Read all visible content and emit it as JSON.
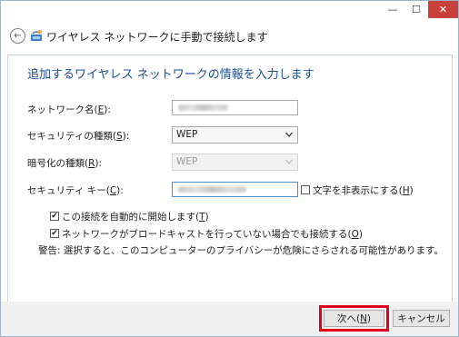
{
  "window": {
    "title": "ワイヤレス ネットワークに手動で接続します",
    "minimize_glyph": "—",
    "maximize_glyph": "☐",
    "close_glyph": "✕",
    "back_glyph": "←"
  },
  "form": {
    "heading": "追加するワイヤレス ネットワークの情報を入力します",
    "network_name": {
      "label": "ネットワーク名(",
      "key": "E",
      "suffix": "):"
    },
    "security_type": {
      "label": "セキュリティの種類(",
      "key": "S",
      "suffix": "):",
      "value": "WEP"
    },
    "encryption_type": {
      "label": "暗号化の種類(",
      "key": "R",
      "suffix": "):",
      "value": "WEP"
    },
    "security_key": {
      "label": "セキュリティ キー(",
      "key": "C",
      "suffix": "):"
    },
    "hide_chars": {
      "label": "文字を非表示にする(",
      "key": "H",
      "suffix": ")",
      "checked": false
    },
    "auto_start": {
      "label": "この接続を自動的に開始します(",
      "key": "T",
      "suffix": ")",
      "checked": true
    },
    "connect_hidden": {
      "label": "ネットワークがブロードキャストを行っていない場合でも接続する(",
      "key": "O",
      "suffix": ")",
      "checked": true
    },
    "warning": "警告: 選択すると、このコンピューターのプライバシーが危険にさらされる可能性があります。"
  },
  "footer": {
    "next": {
      "label": "次へ(",
      "key": "N",
      "suffix": ")"
    },
    "cancel": "キャンセル"
  },
  "colors": {
    "heading": "#1c4e9a",
    "close_button": "#c7413a",
    "highlight": "#e0001a",
    "focus_border": "#4a90d9"
  }
}
